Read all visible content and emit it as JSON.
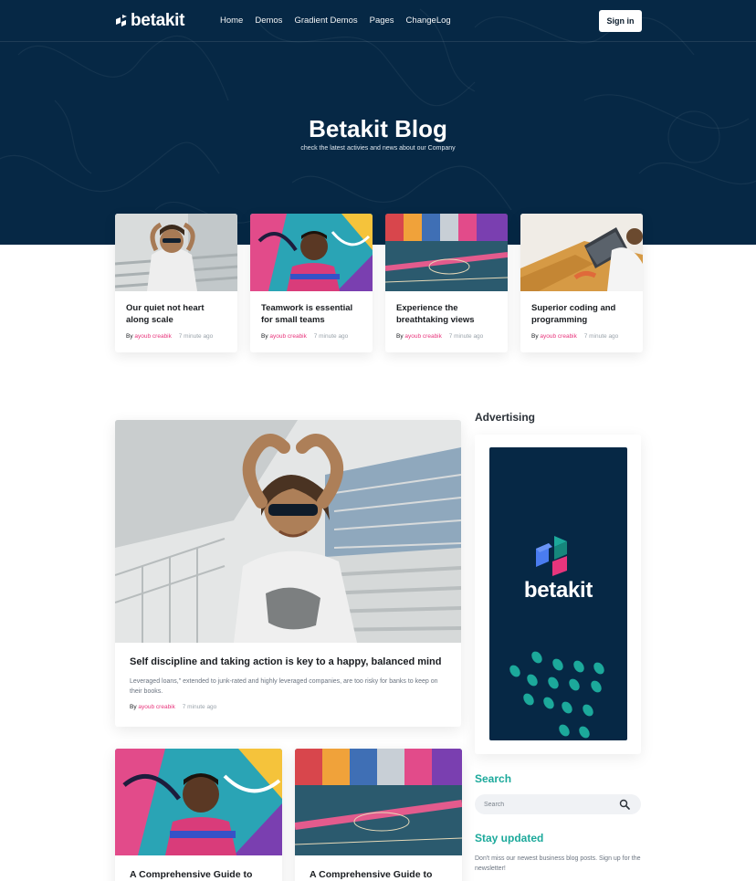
{
  "brand": {
    "name": "betakit",
    "navy": "#062845",
    "pink": "#e8357c",
    "teal": "#1ca99b"
  },
  "nav": {
    "items": [
      "Home",
      "Demos",
      "Gradient Demos",
      "Pages",
      "ChangeLog"
    ],
    "signin_label": "Sign in"
  },
  "hero": {
    "title": "Betakit Blog",
    "subtitle": "check the latest activies and news about our Company"
  },
  "featured": [
    {
      "title": "Our quiet not heart along scale",
      "by": "By",
      "author": "ayoub creabik",
      "time": "7 minute ago",
      "image": "man-sunglasses-stairs"
    },
    {
      "title": "Teamwork is essential for small teams",
      "by": "By",
      "author": "ayoub creabik",
      "time": "7 minute ago",
      "image": "man-graffiti-wall"
    },
    {
      "title": "Experience the breathtaking views",
      "by": "By",
      "author": "ayoub creabik",
      "time": "7 minute ago",
      "image": "colorful-basketball-court"
    },
    {
      "title": "Superior coding and programming",
      "by": "By",
      "author": "ayoub creabik",
      "time": "7 minute ago",
      "image": "person-laptop-couch"
    }
  ],
  "main_post": {
    "title": "Self discipline and taking action is key to a happy, balanced mind",
    "excerpt": "Leveraged loans,\" extended to junk-rated and highly leveraged companies, are too risky for banks to keep on their books.",
    "by": "By",
    "author": "ayoub creabik",
    "time": "7 minute ago",
    "image": "man-sunglasses-stairs"
  },
  "small_posts": [
    {
      "title": "A Comprehensive Guide to",
      "image": "man-graffiti-wall"
    },
    {
      "title": "A Comprehensive Guide to",
      "image": "colorful-basketball-court"
    }
  ],
  "sidebar": {
    "advertising_heading": "Advertising",
    "ad_brand": "betakit",
    "search_heading": "Search",
    "search_placeholder": "Search",
    "stay_heading": "Stay updated",
    "stay_text": "Don't miss our newest business blog posts. Sign up for the newsletter!"
  }
}
